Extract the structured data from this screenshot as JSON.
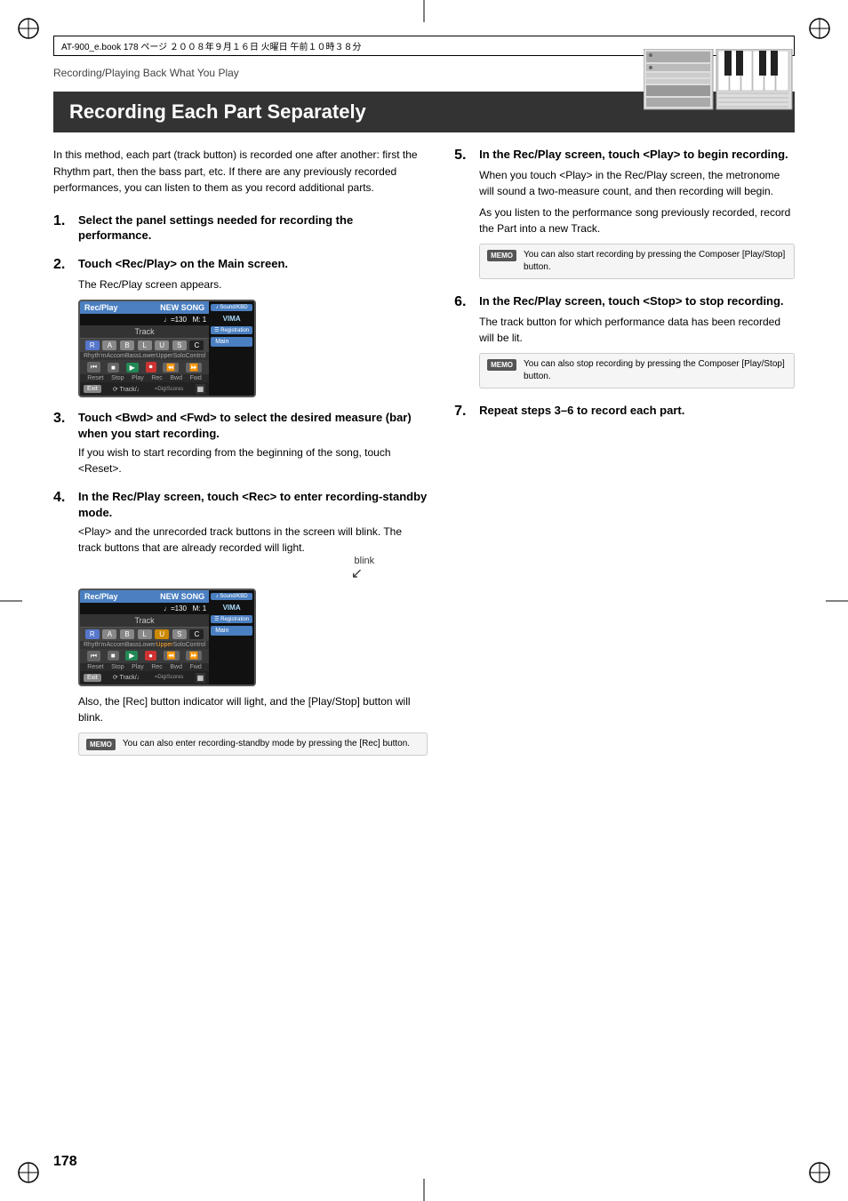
{
  "header": {
    "file_info": "AT-900_e.book  178 ページ  ２００８年９月１６日  火曜日  午前１０時３８分"
  },
  "page": {
    "subtitle": "Recording/Playing Back What You Play",
    "title": "Recording Each Part Separately",
    "page_number": "178"
  },
  "intro": {
    "text": "In this method, each part (track button) is recorded one after another: first the Rhythm part, then the bass part, etc. If there are any previously recorded performances, you can listen to them as you record additional parts."
  },
  "steps": [
    {
      "number": "1.",
      "title": "Select the panel settings needed for recording the performance.",
      "body": ""
    },
    {
      "number": "2.",
      "title": "Touch <Rec/Play> on the Main screen.",
      "body": "The Rec/Play screen appears."
    },
    {
      "number": "3.",
      "title": "Touch <Bwd> and <Fwd> to select the desired measure (bar) when you start recording.",
      "body": "If you wish to start recording from the beginning of the song, touch <Reset>."
    },
    {
      "number": "4.",
      "title": "In the Rec/Play screen, touch <Rec> to enter recording-standby mode.",
      "body": "<Play> and the unrecorded track buttons in the screen will blink. The track buttons that are already recorded will light."
    },
    {
      "number": "5.",
      "title": "In the Rec/Play screen, touch <Play> to begin recording.",
      "body_para1": "When you touch <Play> in the Rec/Play screen, the metronome will sound a two-measure count, and then recording will begin.",
      "body_para2": "As you listen to the performance song previously recorded, record the Part into a new Track."
    },
    {
      "number": "6.",
      "title": "In the Rec/Play screen, touch <Stop> to stop recording.",
      "body": "The track button for which performance data has been recorded will be lit."
    },
    {
      "number": "7.",
      "title": "Repeat steps 3–6 to record each part.",
      "body": ""
    }
  ],
  "screen1": {
    "title_left": "Rec/Play",
    "title_right": "NEW SONG",
    "tempo": "♩=130  M: 1",
    "track_label": "Track",
    "buttons": [
      "R",
      "A",
      "B",
      "L",
      "U",
      "S",
      "C"
    ],
    "button_labels": [
      "Rhyth'm",
      "Accom",
      "Bass",
      "Lower",
      "Upper",
      "Solo",
      "Control"
    ],
    "controls": [
      "Reset",
      "Stop",
      "Play",
      "Rec",
      "Bwd",
      "Fwd"
    ],
    "bottom": [
      "Exit",
      "Track/♩",
      "=DigiScores"
    ],
    "side_items": [
      "Sound/KBD",
      "VIMA",
      "Registration",
      "Main"
    ]
  },
  "screen2": {
    "title_left": "Rec/Play",
    "title_right": "NEW SONG",
    "tempo": "♩=130  M: 1",
    "track_label": "Track",
    "buttons": [
      "R",
      "A",
      "B",
      "L",
      "U",
      "S",
      "C"
    ],
    "button_labels": [
      "Rhyth'm",
      "Accom",
      "Bass",
      "Lower",
      "Upper",
      "Solo",
      "Control"
    ],
    "controls": [
      "Reset",
      "Stop",
      "Play",
      "Rec",
      "Bwd",
      "Fwd"
    ],
    "bottom": [
      "Exit",
      "Track/♩",
      "=DigiScores"
    ],
    "side_items": [
      "Sound/KBD",
      "VIMA",
      "Registration",
      "Main"
    ],
    "blink_label": "blink"
  },
  "memos": [
    {
      "id": "memo1",
      "tag": "MEMO",
      "text": "You can also start recording by pressing the Composer [Play/Stop] button."
    },
    {
      "id": "memo2",
      "tag": "MEMO",
      "text": "You can also stop recording by pressing the Composer [Play/Stop] button."
    },
    {
      "id": "memo3",
      "tag": "MEMO",
      "text": "You can also enter recording-standby mode by pressing the [Rec] button."
    }
  ],
  "also_text": "Also, the [Rec] button indicator will light, and the [Play/Stop] button will blink."
}
